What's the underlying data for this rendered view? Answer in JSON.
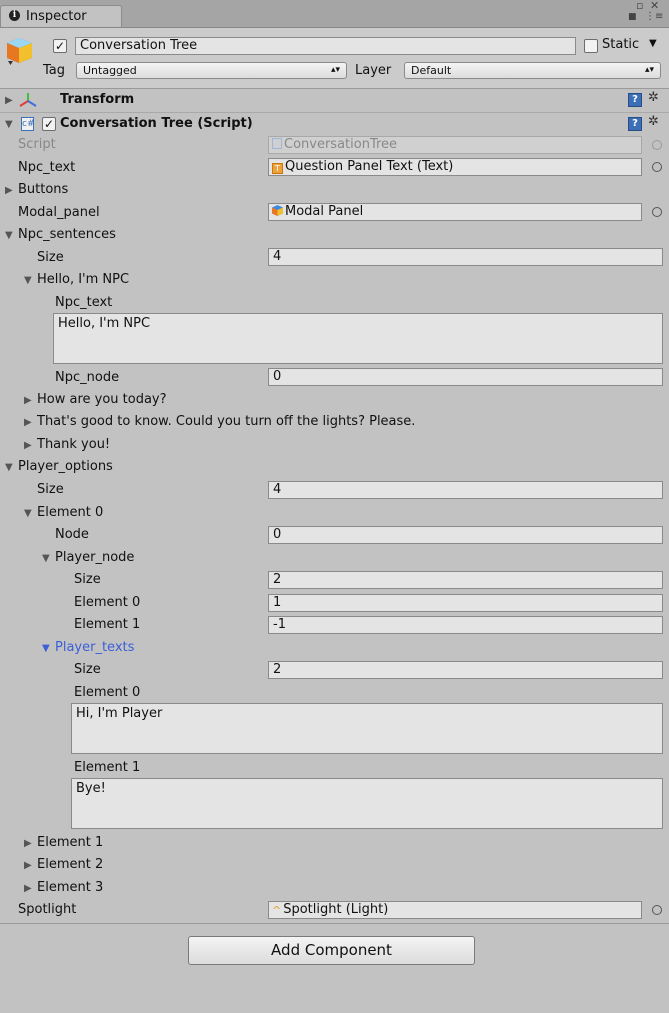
{
  "window": {
    "tab_label": "Inspector",
    "tab_icon": "i",
    "min_glyph": "▫",
    "close_glyph": "✕",
    "lock_glyph": "🔒︎",
    "menu_glyph": "⋮≡"
  },
  "header": {
    "object_name": "Conversation Tree",
    "static_label": "Static",
    "tag_label": "Tag",
    "tag_value": "Untagged",
    "layer_label": "Layer",
    "layer_value": "Default"
  },
  "components": {
    "transform_title": "Transform",
    "script_title": "Conversation Tree (Script)"
  },
  "fields": {
    "script_label": "Script",
    "script_value": "ConversationTree",
    "npc_text_label": "Npc_text",
    "npc_text_value": "Question Panel Text (Text)",
    "buttons_label": "Buttons",
    "modal_panel_label": "Modal_panel",
    "modal_panel_value": "Modal Panel",
    "npc_sentences_label": "Npc_sentences",
    "size_label": "Size",
    "npc_sentences_size": "4",
    "sentence0_label": "Hello, I'm NPC",
    "sentence0_npc_text_label": "Npc_text",
    "sentence0_npc_text_value": "Hello, I'm NPC",
    "sentence0_npc_node_label": "Npc_node",
    "sentence0_npc_node_value": "0",
    "sentence1_label": "How are you today?",
    "sentence2_label": "That's good to know. Could you turn off the lights? Please.",
    "sentence3_label": "Thank you!",
    "player_options_label": "Player_options",
    "player_options_size": "4",
    "element0_label": "Element 0",
    "node_label": "Node",
    "node_value": "0",
    "player_node_label": "Player_node",
    "player_node_size": "2",
    "player_node_el0_label": "Element 0",
    "player_node_el0_value": "1",
    "player_node_el1_label": "Element 1",
    "player_node_el1_value": "-1",
    "player_texts_label": "Player_texts",
    "player_texts_size": "2",
    "player_texts_el0_label": "Element 0",
    "player_texts_el0_value": "Hi, I'm Player",
    "player_texts_el1_label": "Element 1",
    "player_texts_el1_value": "Bye!",
    "element1_label": "Element 1",
    "element2_label": "Element 2",
    "element3_label": "Element 3",
    "spotlight_label": "Spotlight",
    "spotlight_value": "Spotlight (Light)"
  },
  "footer": {
    "add_component_label": "Add Component"
  },
  "colors": {
    "selected": "#3a5fd9",
    "background": "#c2c2c2",
    "field": "#e4e4e4"
  }
}
